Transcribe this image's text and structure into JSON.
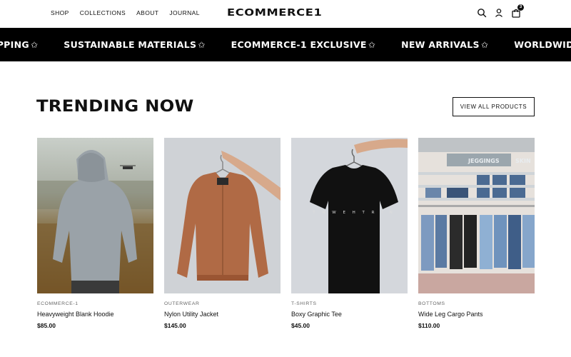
{
  "header": {
    "nav": [
      "SHOP",
      "COLLECTIONS",
      "ABOUT",
      "JOURNAL"
    ],
    "logo": "ECOMMERCE1",
    "cart_count": "3",
    "icons": [
      "search-icon",
      "account-icon",
      "cart-icon"
    ]
  },
  "marquee": {
    "items": [
      "HIPPING",
      "SUSTAINABLE MATERIALS",
      "ECOMMERCE-1 EXCLUSIVE",
      "NEW ARRIVALS",
      "WORLDWIDE SHI"
    ],
    "star": "✩"
  },
  "section": {
    "title": "TRENDING NOW",
    "view_all": "VIEW ALL PRODUCTS"
  },
  "products": [
    {
      "category": "ECOMMERCE-1",
      "name": "Heavyweight Blank Hoodie",
      "price": "$85.00"
    },
    {
      "category": "OUTERWEAR",
      "name": "Nylon Utility Jacket",
      "price": "$145.00"
    },
    {
      "category": "T-SHIRTS",
      "name": "Boxy Graphic Tee",
      "price": "$45.00"
    },
    {
      "category": "BOTTOMS",
      "name": "Wide Leg Cargo Pants",
      "price": "$110.00"
    }
  ],
  "colors": {
    "background": "#ffffff",
    "text": "#111111",
    "banner": "#000000",
    "muted": "#666666"
  }
}
